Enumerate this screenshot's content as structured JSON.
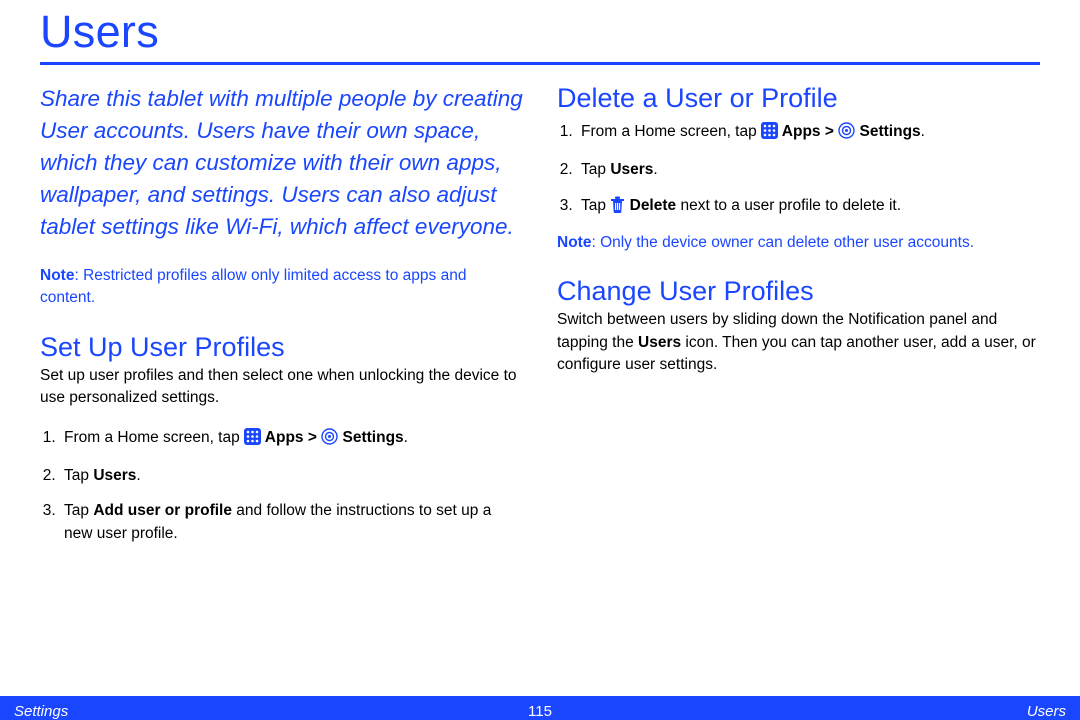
{
  "title": "Users",
  "intro": "Share this tablet with multiple people by creating User accounts. Users have their own space, which they can customize with their own apps, wallpaper, and settings. Users can also adjust tablet settings like Wi-Fi, which affect everyone.",
  "left_note": {
    "label": "Note",
    "text": ": Restricted profiles allow only limited access to apps and content."
  },
  "setup": {
    "heading": "Set Up User Profiles",
    "desc": "Set up user profiles and then select one when unlocking the device to use personalized settings.",
    "step1a": "From a Home screen, tap ",
    "step1_apps": " Apps > ",
    "step1_settings": " Settings",
    "step1_period": ".",
    "step2a": "Tap ",
    "step2b": "Users",
    "step2c": ".",
    "step3a": "Tap ",
    "step3b": "Add user or profile",
    "step3c": " and follow the instructions to set up a new user profile."
  },
  "delete": {
    "heading": "Delete a User or Profile",
    "step1a": "From a Home screen, tap ",
    "step1_apps": " Apps > ",
    "step1_settings": " Settings",
    "step1_period": ".",
    "step2a": "Tap ",
    "step2b": "Users",
    "step2c": ".",
    "step3a": "Tap ",
    "step3b": " Delete",
    "step3c": " next to a user profile to delete it.",
    "note_label": "Note",
    "note_text": ": Only the device owner can delete other user accounts."
  },
  "change": {
    "heading": "Change User Profiles",
    "text_a": "Switch between users by sliding down the Notification panel and tapping the ",
    "text_b": "Users",
    "text_c": " icon. Then you can tap another user, add a user, or configure user settings."
  },
  "footer": {
    "left": "Settings",
    "center": "115",
    "right": "Users"
  }
}
